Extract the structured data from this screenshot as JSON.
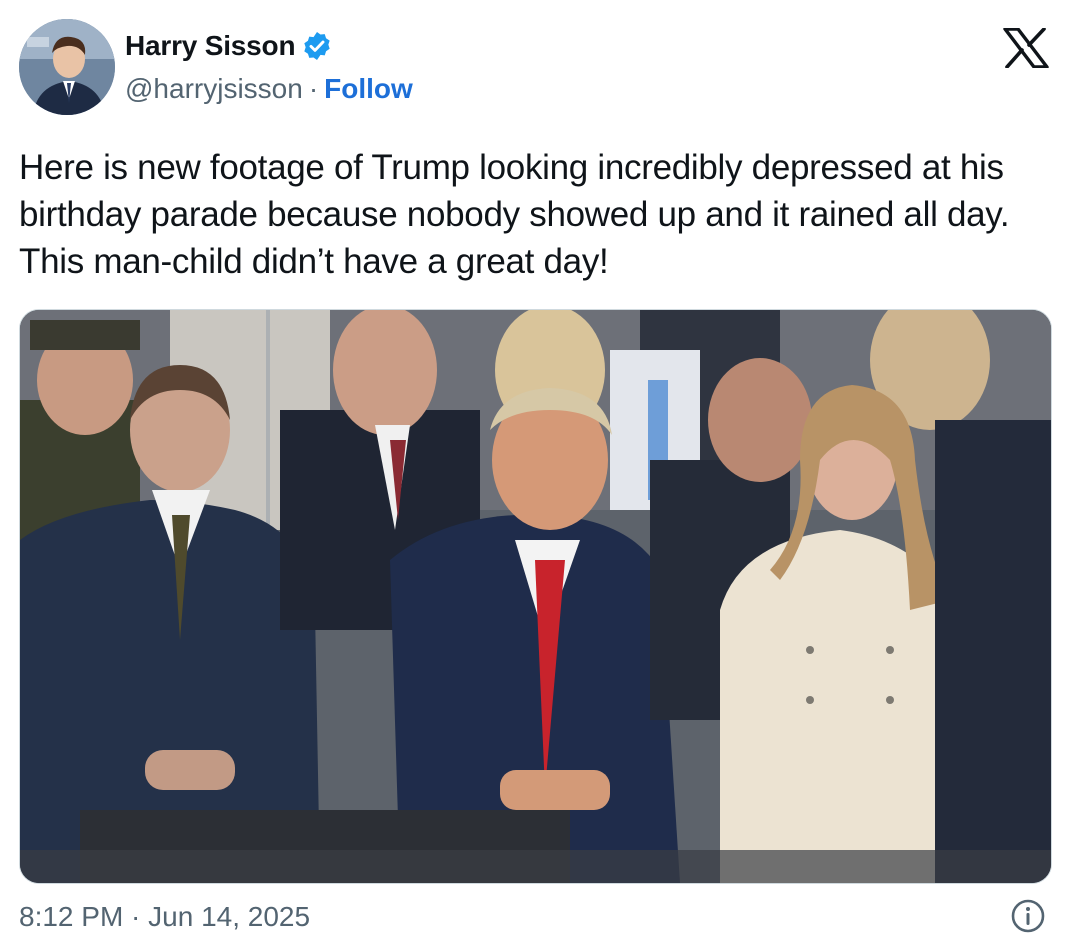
{
  "author": {
    "name": "Harry Sisson",
    "handle": "@harryjsisson",
    "separator": "·",
    "follow_label": "Follow",
    "verified": true
  },
  "tweet": {
    "text": "Here is new footage of Trump looking incredibly depressed at his birthday parade because nobody showed up and it rained all day. This man-child didn’t have a great day!",
    "timestamp": "8:12 PM · Jun 14, 2025"
  },
  "icons": {
    "verified": "verified-badge-icon",
    "platform": "x-logo-icon",
    "info": "info-icon"
  },
  "colors": {
    "link": "#1d6fd8",
    "verified": "#1d9bf0",
    "secondary_text": "#536471"
  }
}
